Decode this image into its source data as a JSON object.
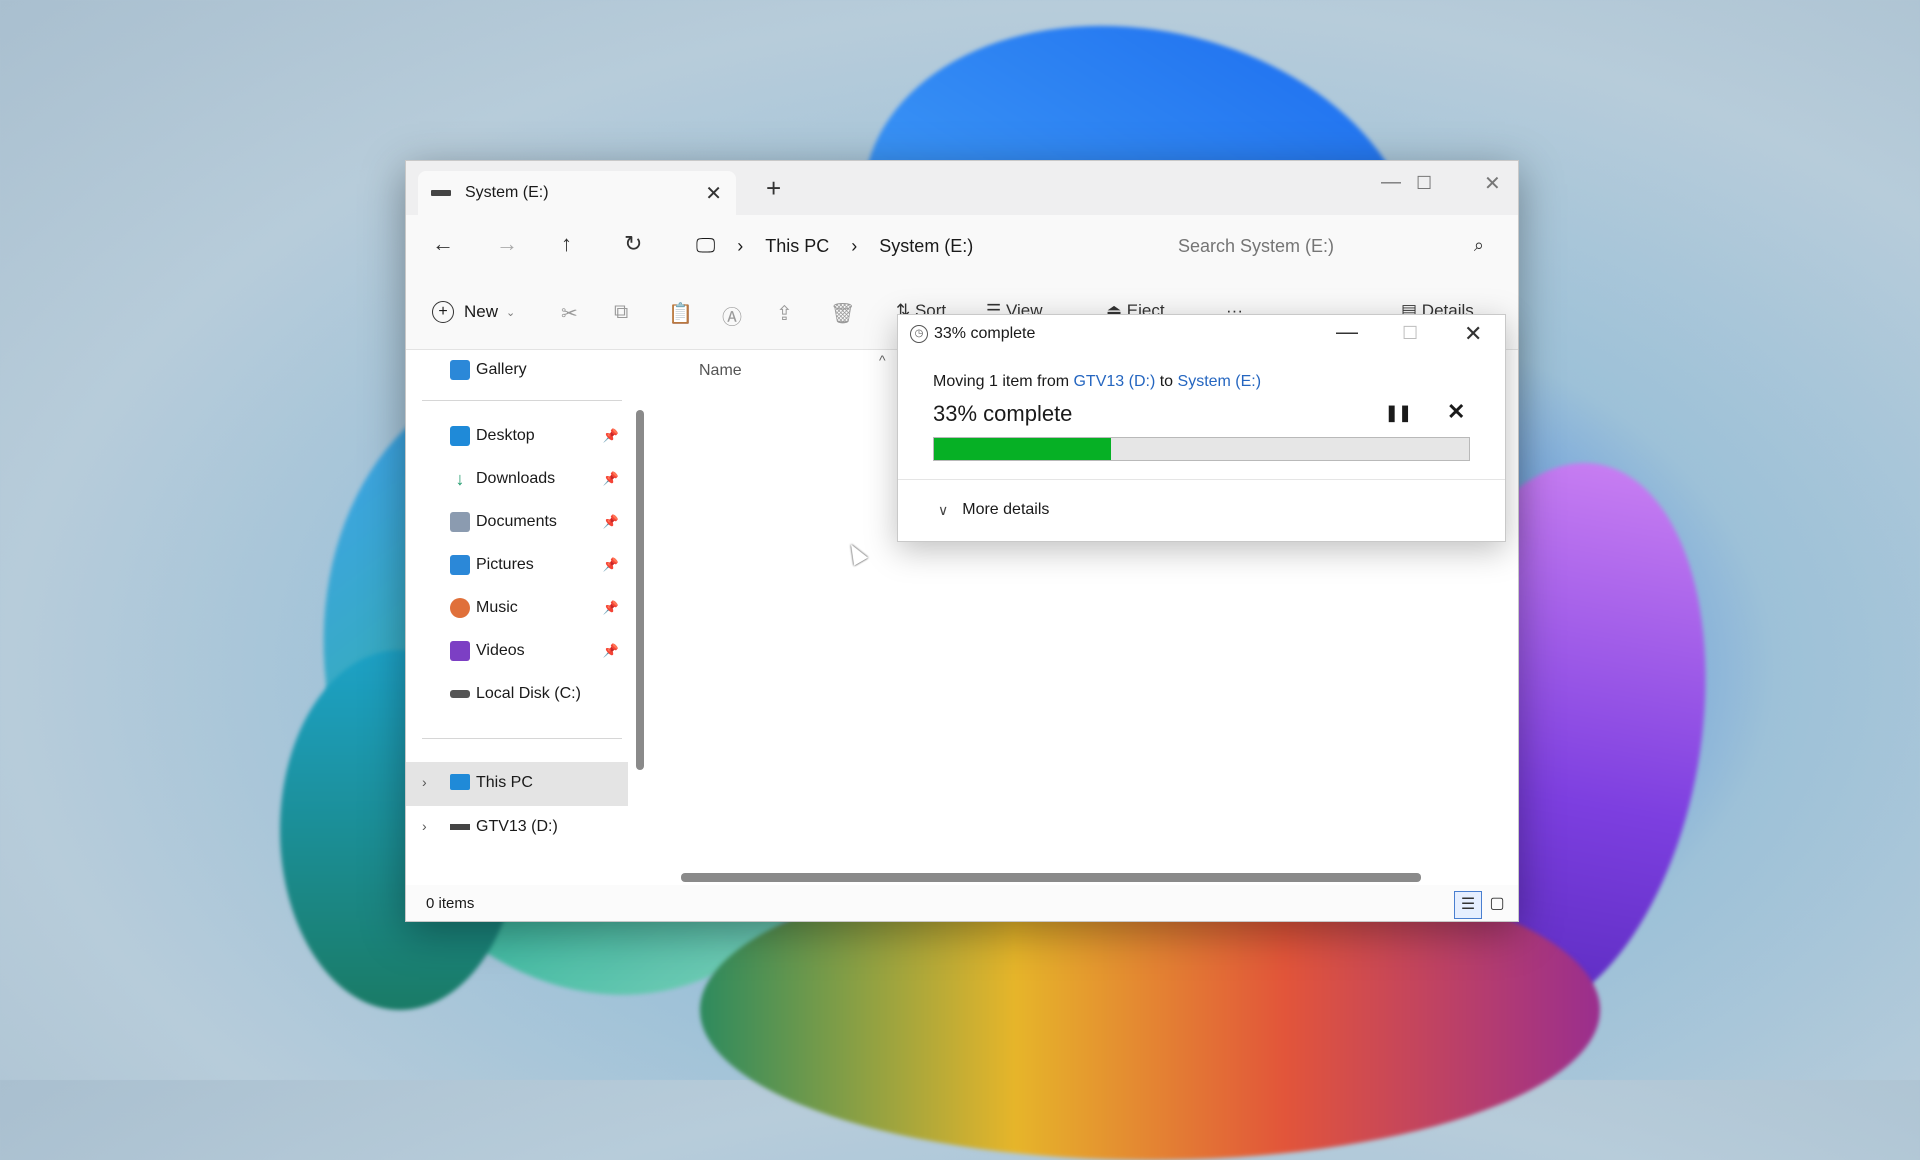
{
  "window": {
    "tab_title": "System (E:)",
    "new_tab": "+",
    "minimize": "—",
    "maximize": "☐",
    "close": "✕"
  },
  "navigation": {
    "back": "←",
    "forward": "→",
    "up": "↑",
    "refresh": "↻",
    "breadcrumbs": [
      "This PC",
      "System (E:)"
    ],
    "search_placeholder": "Search System (E:)"
  },
  "command_bar": {
    "new_label": "New",
    "sort_label": "Sort",
    "view_label": "View",
    "eject_label": "Eject",
    "more_label": "···",
    "details_label": "Details"
  },
  "sidebar": {
    "gallery": "Gallery",
    "quick_access": [
      {
        "label": "Desktop",
        "icon": "desktop-icon",
        "color": "#1f8ad8"
      },
      {
        "label": "Downloads",
        "icon": "downloads-icon",
        "color": "#1d9a6c"
      },
      {
        "label": "Documents",
        "icon": "documents-icon",
        "color": "#8b9bb0"
      },
      {
        "label": "Pictures",
        "icon": "pictures-icon",
        "color": "#2b88d8"
      },
      {
        "label": "Music",
        "icon": "music-icon",
        "color": "#e0703a"
      },
      {
        "label": "Videos",
        "icon": "videos-icon",
        "color": "#7c3fc4"
      },
      {
        "label": "Local Disk (C:)",
        "icon": "drive-icon",
        "color": "#555555"
      }
    ],
    "this_pc": "This PC",
    "drive_d": "GTV13 (D:)"
  },
  "content": {
    "column_name": "Name"
  },
  "status": {
    "items": "0 items"
  },
  "dialog": {
    "title": "33% complete",
    "moving_prefix": "Moving 1 item from ",
    "source": "GTV13 (D:)",
    "to_word": " to ",
    "destination": "System (E:)",
    "heading": "33% complete",
    "progress_fraction": 0.33,
    "more_details": "More details",
    "accent_color": "#06b025"
  }
}
